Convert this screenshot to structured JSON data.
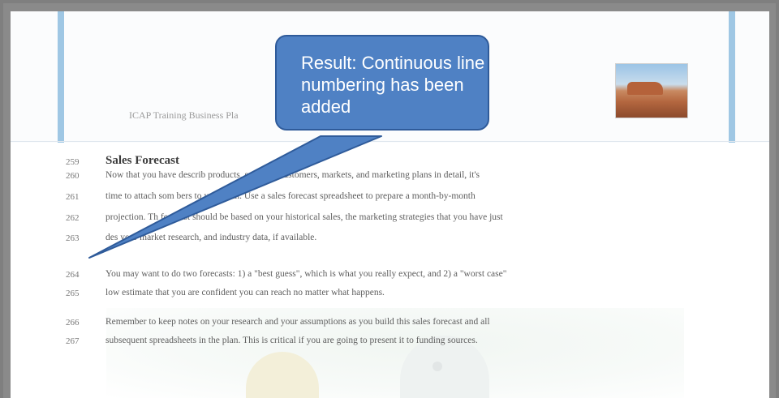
{
  "document": {
    "header_title": "ICAP Training Business Pla",
    "heading": "Sales Forecast",
    "lines": [
      {
        "num": "259",
        "text": ""
      },
      {
        "num": "260",
        "text": "Now that you have describ                products, services, customers, markets, and marketing plans in detail, it's"
      },
      {
        "num": "261",
        "text": "time to attach som           bers to your plan. Use a sales forecast spreadsheet to prepare a month-by-month"
      },
      {
        "num": "262",
        "text": "projection. Th    forecast should be based on your historical sales, the marketing strategies that you have just"
      },
      {
        "num": "263",
        "text": "des        your market research, and industry data, if available."
      },
      {
        "num": "264",
        "text": "You may want to do two forecasts: 1) a \"best guess\", which is what you really expect, and 2) a \"worst case\""
      },
      {
        "num": "265",
        "text": "low estimate that you are confident you can reach no matter what happens."
      },
      {
        "num": "266",
        "text": "Remember to keep notes on your research and your assumptions as you build this sales forecast and all"
      },
      {
        "num": "267",
        "text": "subsequent spreadsheets in the plan. This is critical if you are going to present it to funding sources."
      }
    ]
  },
  "callout": {
    "text": "Result: Continuous line numbering has been added",
    "fill": "#4f81c4",
    "border": "#2f5b9a"
  },
  "colors": {
    "margin_rule": "#9fc7e4",
    "background": "#7f7f7f"
  }
}
